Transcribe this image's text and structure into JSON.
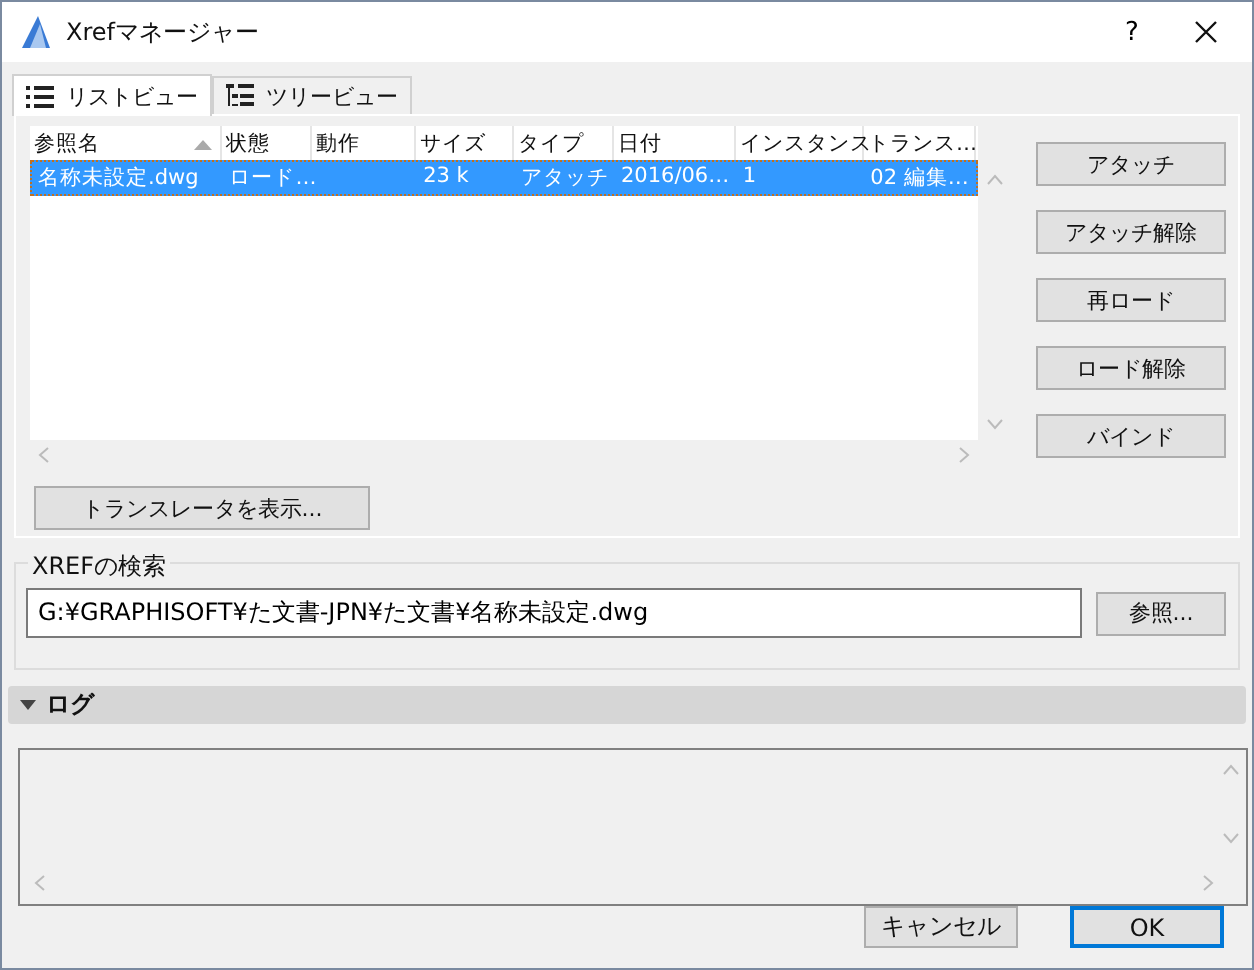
{
  "window": {
    "title": "Xrefマネージャー",
    "help": "?"
  },
  "tabs": [
    {
      "label": "リストビュー",
      "selected": true,
      "kind": "list"
    },
    {
      "label": "ツリービュー",
      "selected": false,
      "kind": "tree"
    }
  ],
  "table": {
    "columns": [
      {
        "label": "参照名",
        "sorted": true
      },
      {
        "label": "状態",
        "sorted": false
      },
      {
        "label": "動作",
        "sorted": false
      },
      {
        "label": "サイズ",
        "sorted": false
      },
      {
        "label": "タイプ",
        "sorted": false
      },
      {
        "label": "日付",
        "sorted": false
      },
      {
        "label": "インスタンス",
        "sorted": false
      },
      {
        "label": "トランス…",
        "sorted": false
      }
    ],
    "rows": [
      {
        "selected": true,
        "cells": [
          "名称未設定.dwg",
          "ロード…",
          "",
          "23 k",
          "アタッチ",
          "2016/06…",
          "1",
          "02 編集…"
        ]
      }
    ]
  },
  "side_buttons": [
    "アタッチ",
    "アタッチ解除",
    "再ロード",
    "ロード解除",
    "バインド"
  ],
  "translator_button": "トランスレータを表示...",
  "search": {
    "label": "XREFの検索",
    "value": "G:¥GRAPHISOFT¥た文書-JPN¥た文書¥名称未設定.dwg",
    "browse": "参照..."
  },
  "log": {
    "title": "ログ",
    "expanded": true
  },
  "buttons": [
    {
      "label": "キャンセル",
      "default": false
    },
    {
      "label": "OK",
      "default": true
    }
  ]
}
